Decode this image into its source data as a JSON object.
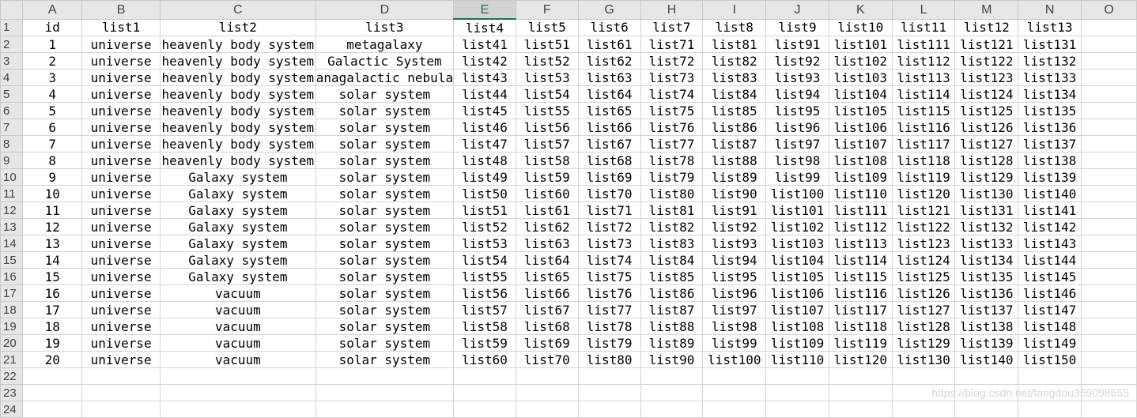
{
  "columns": [
    "A",
    "B",
    "C",
    "D",
    "E",
    "F",
    "G",
    "H",
    "I",
    "J",
    "K",
    "L",
    "M",
    "N",
    "O"
  ],
  "selected_column": "E",
  "rows": [
    [
      "id",
      "list1",
      "list2",
      "list3",
      "list4",
      "list5",
      "list6",
      "list7",
      "list8",
      "list9",
      "list10",
      "list11",
      "list12",
      "list13",
      ""
    ],
    [
      "1",
      "universe",
      "heavenly body system",
      "metagalaxy",
      "list41",
      "list51",
      "list61",
      "list71",
      "list81",
      "list91",
      "list101",
      "list111",
      "list121",
      "list131",
      ""
    ],
    [
      "2",
      "universe",
      "heavenly body system",
      "Galactic System",
      "list42",
      "list52",
      "list62",
      "list72",
      "list82",
      "list92",
      "list102",
      "list112",
      "list122",
      "list132",
      ""
    ],
    [
      "3",
      "universe",
      "heavenly body system",
      "anagalactic nebula",
      "list43",
      "list53",
      "list63",
      "list73",
      "list83",
      "list93",
      "list103",
      "list113",
      "list123",
      "list133",
      ""
    ],
    [
      "4",
      "universe",
      "heavenly body system",
      "solar system",
      "list44",
      "list54",
      "list64",
      "list74",
      "list84",
      "list94",
      "list104",
      "list114",
      "list124",
      "list134",
      ""
    ],
    [
      "5",
      "universe",
      "heavenly body system",
      "solar system",
      "list45",
      "list55",
      "list65",
      "list75",
      "list85",
      "list95",
      "list105",
      "list115",
      "list125",
      "list135",
      ""
    ],
    [
      "6",
      "universe",
      "heavenly body system",
      "solar system",
      "list46",
      "list56",
      "list66",
      "list76",
      "list86",
      "list96",
      "list106",
      "list116",
      "list126",
      "list136",
      ""
    ],
    [
      "7",
      "universe",
      "heavenly body system",
      "solar system",
      "list47",
      "list57",
      "list67",
      "list77",
      "list87",
      "list97",
      "list107",
      "list117",
      "list127",
      "list137",
      ""
    ],
    [
      "8",
      "universe",
      "heavenly body system",
      "solar system",
      "list48",
      "list58",
      "list68",
      "list78",
      "list88",
      "list98",
      "list108",
      "list118",
      "list128",
      "list138",
      ""
    ],
    [
      "9",
      "universe",
      "Galaxy system",
      "solar system",
      "list49",
      "list59",
      "list69",
      "list79",
      "list89",
      "list99",
      "list109",
      "list119",
      "list129",
      "list139",
      ""
    ],
    [
      "10",
      "universe",
      "Galaxy system",
      "solar system",
      "list50",
      "list60",
      "list70",
      "list80",
      "list90",
      "list100",
      "list110",
      "list120",
      "list130",
      "list140",
      ""
    ],
    [
      "11",
      "universe",
      "Galaxy system",
      "solar system",
      "list51",
      "list61",
      "list71",
      "list81",
      "list91",
      "list101",
      "list111",
      "list121",
      "list131",
      "list141",
      ""
    ],
    [
      "12",
      "universe",
      "Galaxy system",
      "solar system",
      "list52",
      "list62",
      "list72",
      "list82",
      "list92",
      "list102",
      "list112",
      "list122",
      "list132",
      "list142",
      ""
    ],
    [
      "13",
      "universe",
      "Galaxy system",
      "solar system",
      "list53",
      "list63",
      "list73",
      "list83",
      "list93",
      "list103",
      "list113",
      "list123",
      "list133",
      "list143",
      ""
    ],
    [
      "14",
      "universe",
      "Galaxy system",
      "solar system",
      "list54",
      "list64",
      "list74",
      "list84",
      "list94",
      "list104",
      "list114",
      "list124",
      "list134",
      "list144",
      ""
    ],
    [
      "15",
      "universe",
      "Galaxy system",
      "solar system",
      "list55",
      "list65",
      "list75",
      "list85",
      "list95",
      "list105",
      "list115",
      "list125",
      "list135",
      "list145",
      ""
    ],
    [
      "16",
      "universe",
      "vacuum",
      "solar system",
      "list56",
      "list66",
      "list76",
      "list86",
      "list96",
      "list106",
      "list116",
      "list126",
      "list136",
      "list146",
      ""
    ],
    [
      "17",
      "universe",
      "vacuum",
      "solar system",
      "list57",
      "list67",
      "list77",
      "list87",
      "list97",
      "list107",
      "list117",
      "list127",
      "list137",
      "list147",
      ""
    ],
    [
      "18",
      "universe",
      "vacuum",
      "solar system",
      "list58",
      "list68",
      "list78",
      "list88",
      "list98",
      "list108",
      "list118",
      "list128",
      "list138",
      "list148",
      ""
    ],
    [
      "19",
      "universe",
      "vacuum",
      "solar system",
      "list59",
      "list69",
      "list79",
      "list89",
      "list99",
      "list109",
      "list119",
      "list129",
      "list139",
      "list149",
      ""
    ],
    [
      "20",
      "universe",
      "vacuum",
      "solar system",
      "list60",
      "list70",
      "list80",
      "list90",
      "list100",
      "list110",
      "list120",
      "list130",
      "list140",
      "list150",
      ""
    ],
    [
      "",
      "",
      "",
      "",
      "",
      "",
      "",
      "",
      "",
      "",
      "",
      "",
      "",
      "",
      ""
    ],
    [
      "",
      "",
      "",
      "",
      "",
      "",
      "",
      "",
      "",
      "",
      "",
      "",
      "",
      "",
      ""
    ],
    [
      "",
      "",
      "",
      "",
      "",
      "",
      "",
      "",
      "",
      "",
      "",
      "",
      "",
      "",
      ""
    ]
  ],
  "watermark": "https://blog.csdn.net/tangdou369098655"
}
